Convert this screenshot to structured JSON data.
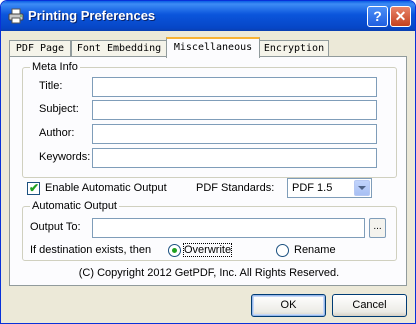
{
  "window": {
    "title": "Printing Preferences",
    "help_symbol": "?",
    "close_symbol": "✕"
  },
  "tabs": [
    {
      "label": "PDF Page",
      "active": false
    },
    {
      "label": "Font Embedding",
      "active": false
    },
    {
      "label": "Miscellaneous",
      "active": true
    },
    {
      "label": "Encryption",
      "active": false
    }
  ],
  "meta_info": {
    "group_label": "Meta Info",
    "fields": [
      {
        "label": "Title:",
        "value": ""
      },
      {
        "label": "Subject:",
        "value": ""
      },
      {
        "label": "Author:",
        "value": ""
      },
      {
        "label": "Keywords:",
        "value": ""
      }
    ]
  },
  "auto_output_checkbox": {
    "label": "Enable Automatic Output",
    "checked": true
  },
  "pdf_standards": {
    "label": "PDF Standards:",
    "selected": "PDF 1.5"
  },
  "automatic_output": {
    "group_label": "Automatic Output",
    "output_to_label": "Output To:",
    "output_to_value": "",
    "browse_label": "...",
    "exists_label": "If destination exists, then",
    "options": [
      {
        "label": "Overwrite",
        "selected": true
      },
      {
        "label": "Rename",
        "selected": false
      }
    ]
  },
  "copyright": "(C) Copyright 2012 GetPDF, Inc.    All Rights Reserved.",
  "buttons": {
    "ok": "OK",
    "cancel": "Cancel"
  },
  "colors": {
    "titlebar": "#0a55dc",
    "dialog_bg": "#ece9d8",
    "active_tab_accent": "#f8b334",
    "check_green": "#21a121"
  }
}
